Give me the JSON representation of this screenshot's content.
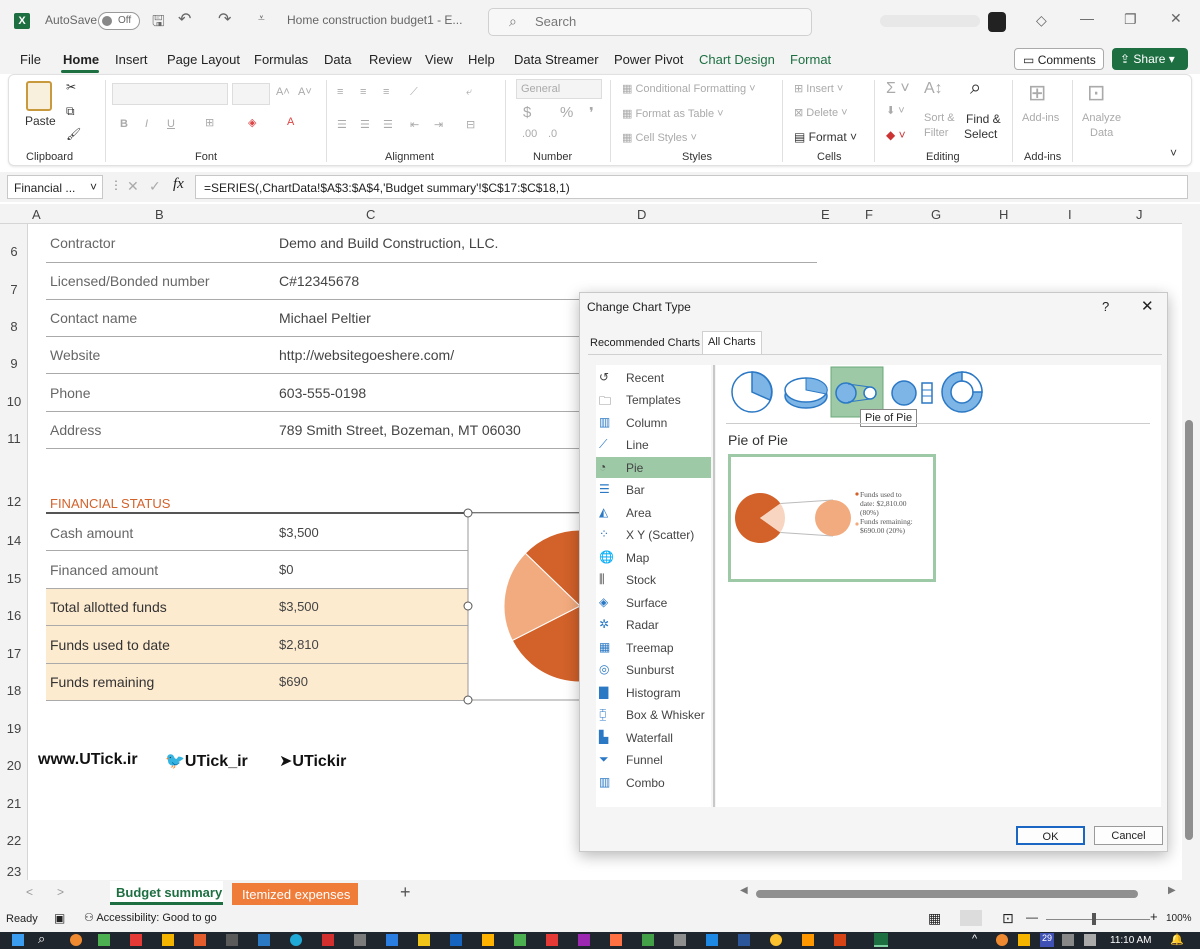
{
  "titlebar": {
    "autosave_label": "AutoSave",
    "autosave_state": "Off",
    "doc_title": "Home construction budget1  -  E...",
    "search_placeholder": "Search"
  },
  "menu": {
    "items": [
      "File",
      "Home",
      "Insert",
      "Page Layout",
      "Formulas",
      "Data",
      "Review",
      "View",
      "Help",
      "Data Streamer",
      "Power Pivot",
      "Chart Design",
      "Format"
    ],
    "comments": "Comments",
    "share": "Share"
  },
  "ribbon": {
    "groups": [
      "Clipboard",
      "Font",
      "Alignment",
      "Number",
      "Styles",
      "Cells",
      "Editing",
      "Add-ins"
    ],
    "paste": "Paste",
    "number_format": "General",
    "conditional_formatting": "Conditional Formatting",
    "format_as_table": "Format as Table",
    "cell_styles": "Cell Styles",
    "insert": "Insert",
    "delete": "Delete",
    "format": "Format",
    "sort_filter": [
      "Sort &",
      "Filter"
    ],
    "find_select": [
      "Find &",
      "Select"
    ],
    "addins": "Add-ins",
    "analyze_data": [
      "Analyze",
      "Data"
    ]
  },
  "formula_bar": {
    "name_box": "Financial ...",
    "formula": "=SERIES(,ChartData!$A$3:$A$4,'Budget summary'!$C$17:$C$18,1)"
  },
  "columns": [
    "A",
    "B",
    "C",
    "D",
    "E",
    "F",
    "G",
    "H",
    "I",
    "J"
  ],
  "rows": [
    "6",
    "7",
    "8",
    "9",
    "10",
    "11",
    "12",
    "14",
    "15",
    "16",
    "17",
    "18",
    "19",
    "20",
    "21",
    "22",
    "23"
  ],
  "contact": [
    {
      "label": "Contractor",
      "value": "Demo and Build Construction, LLC."
    },
    {
      "label": "Licensed/Bonded number",
      "value": "C#12345678"
    },
    {
      "label": "Contact name",
      "value": "Michael Peltier"
    },
    {
      "label": "Website",
      "value": "http://websitegoeshere.com/"
    },
    {
      "label": "Phone",
      "value": "603-555-0198"
    },
    {
      "label": "Address",
      "value": "789 Smith Street, Bozeman, MT 06030"
    }
  ],
  "financial": {
    "heading": "FINANCIAL STATUS",
    "rows": [
      {
        "label": "Cash amount",
        "value": "$3,500"
      },
      {
        "label": "Financed amount",
        "value": "$0"
      },
      {
        "label": "Total allotted funds",
        "value": "$3,500"
      },
      {
        "label": "Funds used to date",
        "value": "$2,810"
      },
      {
        "label": "Funds remaining",
        "value": "$690"
      }
    ]
  },
  "watermark": {
    "site": "www.UTick.ir",
    "twitter": "UTick_ir",
    "telegram": "UTickir"
  },
  "dialog": {
    "title": "Change Chart Type",
    "help": "?",
    "close": "✕",
    "tabs": [
      "Recommended Charts",
      "All Charts"
    ],
    "chart_types": [
      "Recent",
      "Templates",
      "Column",
      "Line",
      "Pie",
      "Bar",
      "Area",
      "X Y (Scatter)",
      "Map",
      "Stock",
      "Surface",
      "Radar",
      "Treemap",
      "Sunburst",
      "Histogram",
      "Box & Whisker",
      "Waterfall",
      "Funnel",
      "Combo"
    ],
    "selected_type": "Pie",
    "subtype_tooltip": "Pie of Pie",
    "subtype_title": "Pie of Pie",
    "preview_legend": [
      "Funds used to",
      "date: $2,810.00",
      "(80%)",
      "Funds remaining:",
      "$690.00 (20%)"
    ],
    "ok": "OK",
    "cancel": "Cancel",
    "colors": {
      "accent": "#9dc9a6",
      "pie_dark": "#d2612a",
      "pie_light": "#f2ab7e"
    }
  },
  "chart_data": {
    "type": "pie",
    "categories": [
      "Funds used to date",
      "Funds remaining"
    ],
    "values": [
      2810,
      690
    ]
  },
  "sheet_tabs": [
    "Budget summary",
    "Itemized expenses"
  ],
  "status": {
    "ready": "Ready",
    "accessibility": "Accessibility: Good to go",
    "zoom": "100%"
  },
  "taskbar": {
    "time": "11:10 AM",
    "date_badge": "29"
  }
}
